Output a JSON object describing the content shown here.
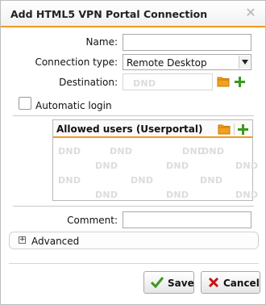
{
  "dialog": {
    "title": "Add HTML5 VPN Portal Connection",
    "close_icon": "close-icon"
  },
  "form": {
    "name_label": "Name:",
    "name_value": "",
    "connection_type_label": "Connection type:",
    "connection_type_value": "Remote Desktop",
    "destination_label": "Destination:",
    "destination_placeholder": "DND",
    "automatic_login_label": "Automatic login",
    "automatic_login_checked": false,
    "comment_label": "Comment:",
    "comment_value": ""
  },
  "allowed_users": {
    "title": "Allowed users (Userportal)",
    "watermark": "DND"
  },
  "advanced": {
    "label": "Advanced",
    "expander": "+"
  },
  "buttons": {
    "save": "Save",
    "cancel": "Cancel"
  },
  "colors": {
    "accent": "#f09a1e",
    "add_green": "#3a9a1a",
    "cancel_red": "#cc1111"
  }
}
